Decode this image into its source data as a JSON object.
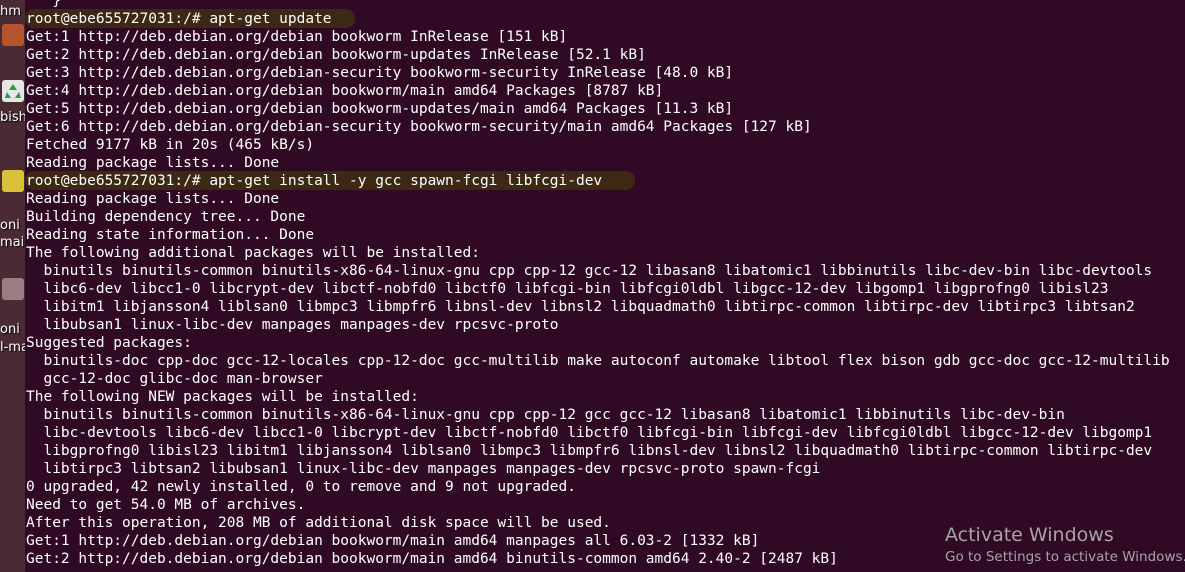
{
  "desktop": {
    "labels": [
      "hm",
      "bish",
      "oni",
      "main",
      "oni",
      "l-ma"
    ]
  },
  "terminal": {
    "lines": [
      "   }",
      "root@ebe655727031:/# apt-get update",
      "Get:1 http://deb.debian.org/debian bookworm InRelease [151 kB]",
      "Get:2 http://deb.debian.org/debian bookworm-updates InRelease [52.1 kB]",
      "Get:3 http://deb.debian.org/debian-security bookworm-security InRelease [48.0 kB]",
      "Get:4 http://deb.debian.org/debian bookworm/main amd64 Packages [8787 kB]",
      "Get:5 http://deb.debian.org/debian bookworm-updates/main amd64 Packages [11.3 kB]",
      "Get:6 http://deb.debian.org/debian-security bookworm-security/main amd64 Packages [127 kB]",
      "Fetched 9177 kB in 20s (465 kB/s)",
      "Reading package lists... Done",
      "root@ebe655727031:/# apt-get install -y gcc spawn-fcgi libfcgi-dev",
      "Reading package lists... Done",
      "Building dependency tree... Done",
      "Reading state information... Done",
      "The following additional packages will be installed:",
      "  binutils binutils-common binutils-x86-64-linux-gnu cpp cpp-12 gcc-12 libasan8 libatomic1 libbinutils libc-dev-bin libc-devtools",
      "  libc6-dev libcc1-0 libcrypt-dev libctf-nobfd0 libctf0 libfcgi-bin libfcgi0ldbl libgcc-12-dev libgomp1 libgprofng0 libisl23",
      "  libitm1 libjansson4 liblsan0 libmpc3 libmpfr6 libnsl-dev libnsl2 libquadmath0 libtirpc-common libtirpc-dev libtirpc3 libtsan2",
      "  libubsan1 linux-libc-dev manpages manpages-dev rpcsvc-proto",
      "Suggested packages:",
      "  binutils-doc cpp-doc gcc-12-locales cpp-12-doc gcc-multilib make autoconf automake libtool flex bison gdb gcc-doc gcc-12-multilib",
      "  gcc-12-doc glibc-doc man-browser",
      "The following NEW packages will be installed:",
      "  binutils binutils-common binutils-x86-64-linux-gnu cpp cpp-12 gcc gcc-12 libasan8 libatomic1 libbinutils libc-dev-bin",
      "  libc-devtools libc6-dev libcc1-0 libcrypt-dev libctf-nobfd0 libctf0 libfcgi-bin libfcgi-dev libfcgi0ldbl libgcc-12-dev libgomp1",
      "  libgprofng0 libisl23 libitm1 libjansson4 liblsan0 libmpc3 libmpfr6 libnsl-dev libnsl2 libquadmath0 libtirpc-common libtirpc-dev",
      "  libtirpc3 libtsan2 libubsan1 linux-libc-dev manpages manpages-dev rpcsvc-proto spawn-fcgi",
      "0 upgraded, 42 newly installed, 0 to remove and 9 not upgraded.",
      "Need to get 54.0 MB of archives.",
      "After this operation, 208 MB of additional disk space will be used.",
      "Get:1 http://deb.debian.org/debian bookworm/main amd64 manpages all 6.03-2 [1332 kB]",
      "Get:2 http://deb.debian.org/debian bookworm/main amd64 binutils-common amd64 2.40-2 [2487 kB]"
    ]
  },
  "watermark": {
    "title": "Activate Windows",
    "subtitle": "Go to Settings to activate Windows."
  },
  "colors": {
    "terminal_bg": "#300a24",
    "text": "#ffffff",
    "highlight": "#3e2a14"
  }
}
